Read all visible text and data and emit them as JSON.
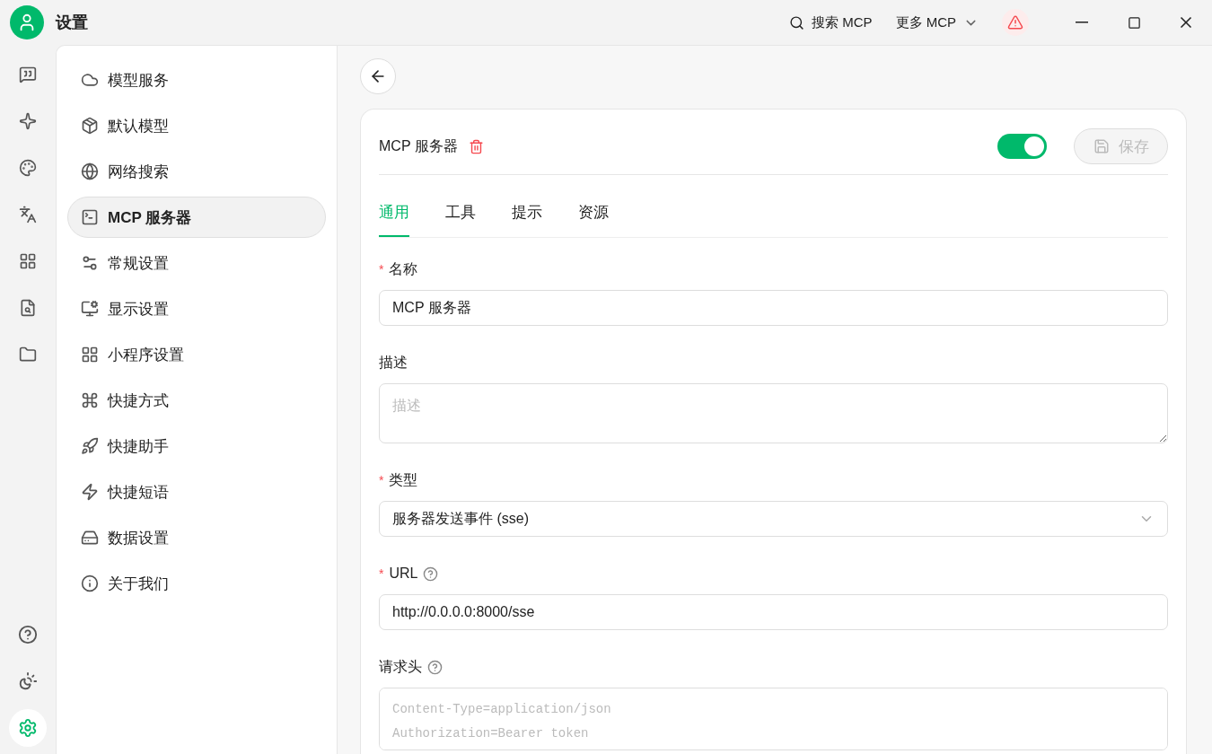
{
  "window": {
    "title": "设置"
  },
  "title_bar": {
    "search_label": "搜索 MCP",
    "more_label": "更多 MCP",
    "warning": true
  },
  "rail": {
    "top": [
      {
        "selected": false
      },
      {
        "selected": false
      },
      {
        "selected": false
      },
      {
        "selected": false
      },
      {
        "selected": false
      },
      {
        "selected": false
      },
      {
        "selected": false
      }
    ],
    "bottom": [
      {
        "selected": false
      },
      {
        "selected": false
      },
      {
        "selected": true
      }
    ]
  },
  "settings_menu": [
    {
      "label": "模型服务",
      "selected": false
    },
    {
      "label": "默认模型",
      "selected": false
    },
    {
      "label": "网络搜索",
      "selected": false
    },
    {
      "label": "MCP 服务器",
      "selected": true
    },
    {
      "label": "常规设置",
      "selected": false
    },
    {
      "label": "显示设置",
      "selected": false
    },
    {
      "label": "小程序设置",
      "selected": false
    },
    {
      "label": "快捷方式",
      "selected": false
    },
    {
      "label": "快捷助手",
      "selected": false
    },
    {
      "label": "快捷短语",
      "selected": false
    },
    {
      "label": "数据设置",
      "selected": false
    },
    {
      "label": "关于我们",
      "selected": false
    }
  ],
  "server": {
    "name": "MCP 服务器",
    "enabled": true,
    "save": {
      "label": "保存",
      "disabled": true
    }
  },
  "tabs": [
    {
      "label": "通用",
      "selected": true
    },
    {
      "label": "工具",
      "selected": false
    },
    {
      "label": "提示",
      "selected": false
    },
    {
      "label": "资源",
      "selected": false
    }
  ],
  "fields": [
    {
      "kind": "input",
      "label": "名称",
      "required_mark": "*",
      "help": false,
      "value": "MCP 服务器"
    },
    {
      "kind": "textarea",
      "label": "描述",
      "help": false,
      "placeholder": "描述"
    },
    {
      "kind": "select",
      "label": "类型",
      "required_mark": "*",
      "help": false,
      "value": "服务器发送事件 (sse)"
    },
    {
      "kind": "input",
      "label": "URL",
      "required_mark": "*",
      "help": true,
      "value": "http://0.0.0.0:8000/sse"
    },
    {
      "kind": "code",
      "label": "请求头",
      "help": true,
      "placeholder": "Content-Type=application/json\nAuthorization=Bearer token"
    }
  ]
}
